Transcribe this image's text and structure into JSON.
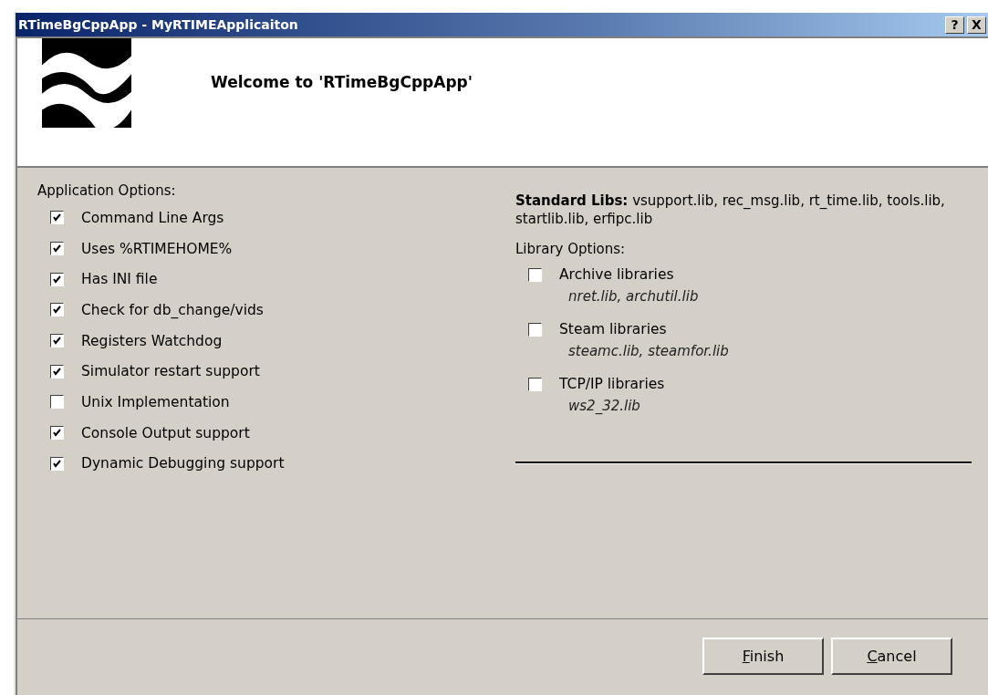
{
  "window": {
    "title": "RTimeBgCppApp - MyRTIMEApplicaiton",
    "controls": [
      {
        "kind": "help",
        "label": "?"
      },
      {
        "kind": "close",
        "label": "X"
      }
    ]
  },
  "header": {
    "welcome": "Welcome to 'RTimeBgCppApp'"
  },
  "application_options": {
    "label": "Application Options:",
    "items": [
      {
        "label": "Command Line Args",
        "checked": true
      },
      {
        "label": "Uses %RTIMEHOME%",
        "checked": true
      },
      {
        "label": "Has INI file",
        "checked": true
      },
      {
        "label": "Check for db_change/vids",
        "checked": true
      },
      {
        "label": "Registers Watchdog",
        "checked": true
      },
      {
        "label": "Simulator restart support",
        "checked": true
      },
      {
        "label": "Unix Implementation",
        "checked": false
      },
      {
        "label": "Console Output support",
        "checked": true
      },
      {
        "label": "Dynamic Debugging support",
        "checked": true
      }
    ]
  },
  "standard_libs": "**Standard Libs:** vsupport.lib, rec_msg.lib, rt_time.lib, tools.lib, startlib.lib, erfipc.lib",
  "library_options": {
    "label": "Library Options:",
    "items": [
      {
        "label": "Archive libraries",
        "checked": false,
        "libs": "nret.lib, archutil.lib"
      },
      {
        "label": "Steam libraries",
        "checked": false,
        "libs": "steamc.lib, steamfor.lib"
      },
      {
        "label": "TCP/IP libraries",
        "checked": false,
        "libs": "ws2_32.lib"
      }
    ]
  },
  "buttons": [
    {
      "label": "Finish",
      "mnemonic_first": true
    },
    {
      "label": "Cancel",
      "mnemonic_first": true
    }
  ]
}
